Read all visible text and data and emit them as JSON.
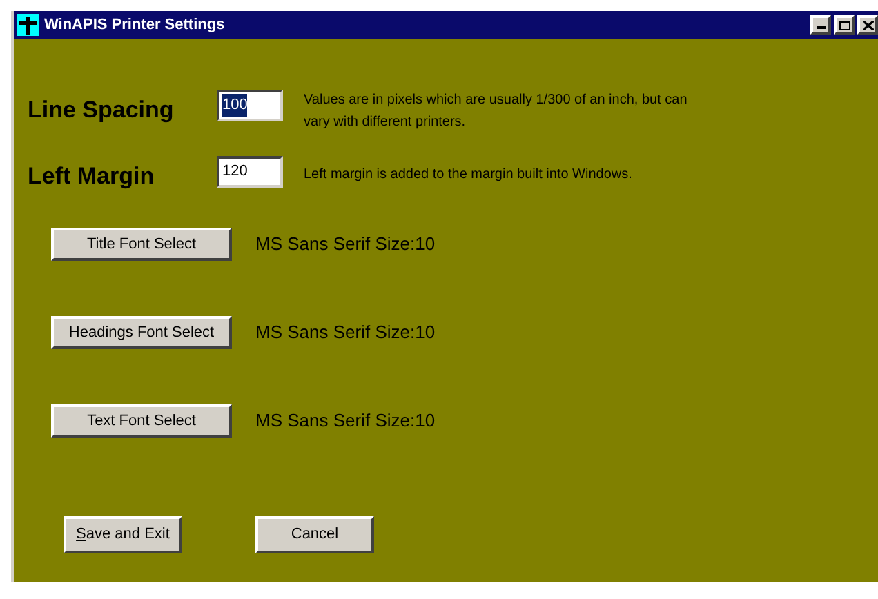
{
  "window": {
    "title": "WinAPIS Printer Settings"
  },
  "settings": [
    {
      "label": "Line Spacing",
      "value": "100",
      "text_selected": true,
      "note": "Values are in pixels which are usually 1/300 of an inch, but can vary with different printers."
    },
    {
      "label": "Left Margin",
      "value": "120",
      "text_selected": false,
      "note": "Left margin is added to the margin built into Windows."
    }
  ],
  "fonts": [
    {
      "button": "Title Font Select",
      "current": "MS Sans Serif Size:10"
    },
    {
      "button": "Headings Font Select",
      "current": "MS Sans Serif Size:10"
    },
    {
      "button": "Text Font Select",
      "current": "MS Sans Serif Size:10"
    }
  ],
  "buttons": [
    {
      "label": "Save and Exit",
      "access_key_underlined": true
    },
    {
      "label": "Cancel",
      "access_key_underlined": false
    }
  ]
}
